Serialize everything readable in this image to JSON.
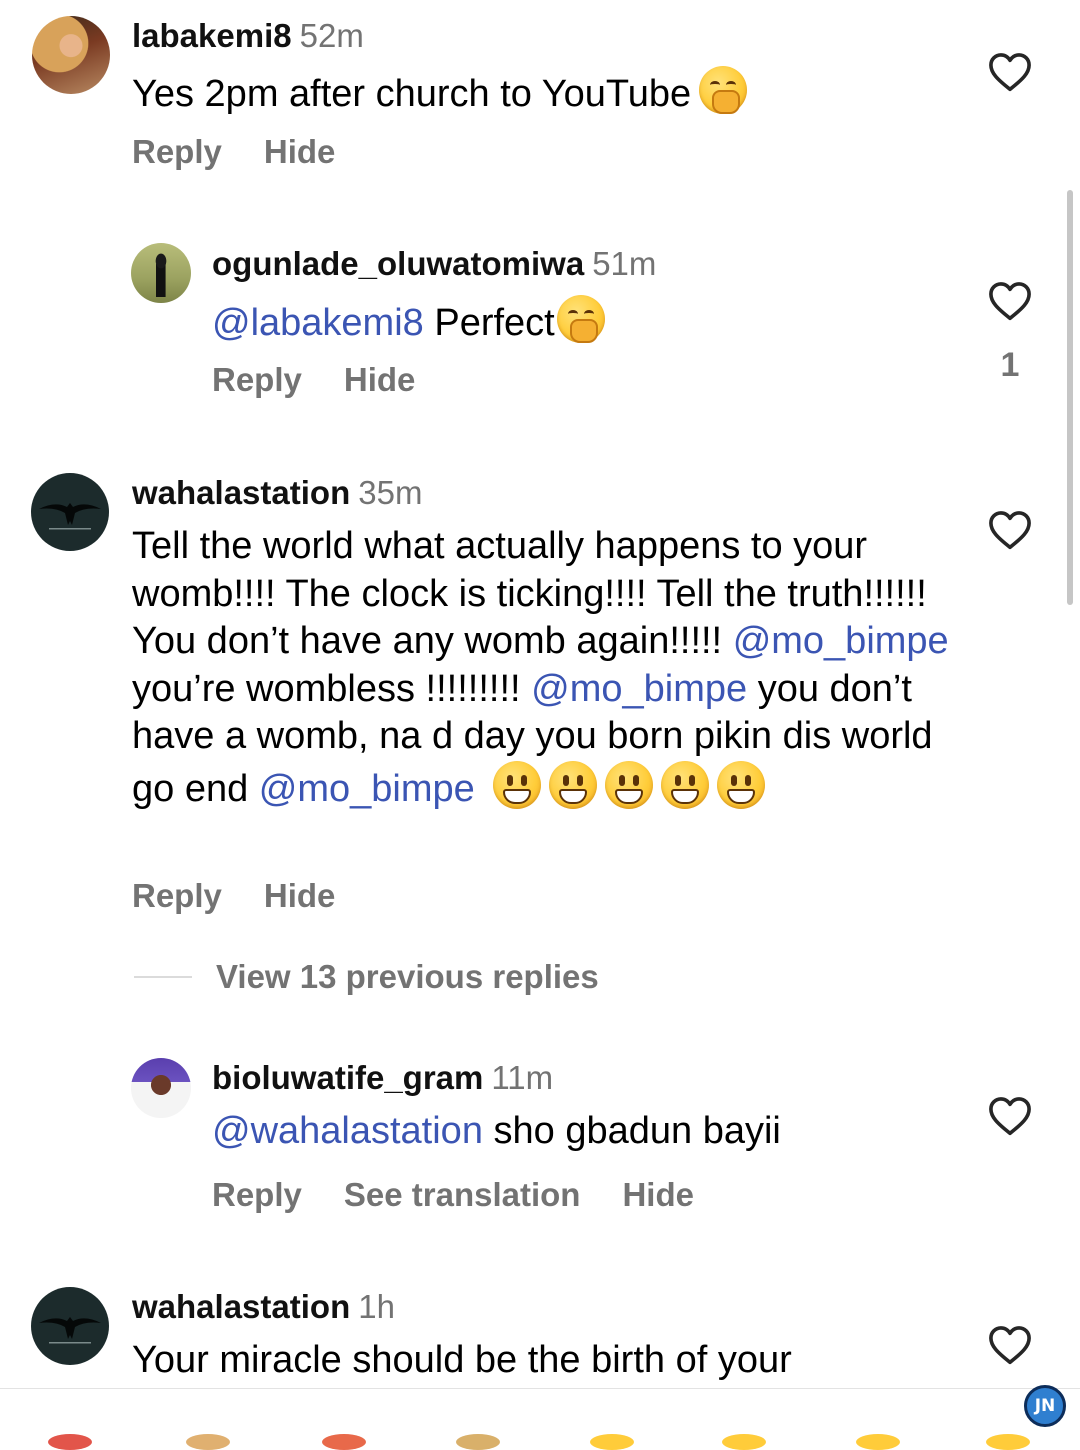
{
  "comments": [
    {
      "username": "labakemi8",
      "time": "52m",
      "text": "Yes 2pm after church to YouTube",
      "actions": [
        "Reply",
        "Hide"
      ]
    },
    {
      "username": "ogunlade_oluwatomiwa",
      "time": "51m",
      "mention": "@labakemi8",
      "text": " Perfect",
      "actions": [
        "Reply",
        "Hide"
      ],
      "likes": "1"
    },
    {
      "username": "wahalastation",
      "time": "35m",
      "text_part1": "Tell the world what actually happens to your womb!!!! The clock is ticking!!!! Tell the truth!!!!!! You don’t have any womb again!!!!!",
      "mention1": "@mo_bimpe",
      "text_part2": " you’re wombless !!!!!!!!!",
      "mention2": "@mo_bimpe",
      "text_part3": " you don’t have a womb, na d day you born pikin dis world go end",
      "mention3": "@mo_bimpe",
      "actions": [
        "Reply",
        "Hide"
      ]
    },
    {
      "username": "bioluwatife_gram",
      "time": "11m",
      "mention": "@wahalastation",
      "text": " sho gbadun bayii",
      "actions": [
        "Reply",
        "See translation",
        "Hide"
      ]
    },
    {
      "username": "wahalastation",
      "time": "1h",
      "text": "Your miracle should be the birth of your"
    }
  ],
  "view_replies_label": "View 13 previous replies",
  "watermark": "JN",
  "colors": {
    "mention": "#3b55b3",
    "secondary_text": "#737373",
    "primary_text": "#000000"
  },
  "icons": {
    "like": "heart-outline-icon",
    "emoji_hand": "face-with-hand-over-mouth-emoji",
    "emoji_grin": "grinning-face-emoji"
  }
}
